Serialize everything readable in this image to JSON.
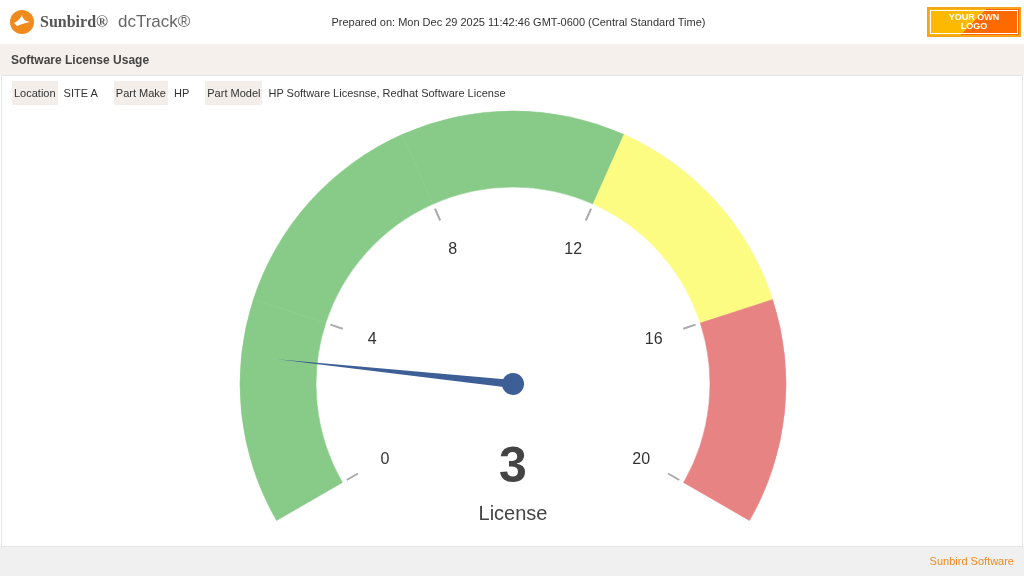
{
  "header": {
    "brand": "Sunbird®",
    "product": "dcTrack®",
    "prepared_on": "Prepared on: Mon Dec 29 2025 11:42:46 GMT-0600 (Central Standard Time)",
    "custom_logo": "YOUR OWN LOGO"
  },
  "report": {
    "title": "Software License Usage",
    "filters": [
      {
        "label": "Location",
        "value": "SITE A"
      },
      {
        "label": "Part Make",
        "value": "HP"
      },
      {
        "label": "Part Model",
        "value": "HP Software Licesnse, Redhat Software License"
      }
    ],
    "gauge": {
      "value": "3",
      "unit": "License",
      "ticks": [
        {
          "label": "0"
        },
        {
          "label": "4",
          "color": "#88cb88"
        },
        {
          "label": "8",
          "color": "#88cb88"
        },
        {
          "label": "12",
          "color": "#88cb88"
        },
        {
          "label": "16",
          "color": "#fcfc82"
        },
        {
          "label": "20",
          "color": "#e88384"
        }
      ]
    }
  },
  "footer": {
    "text": "Sunbird Software"
  }
}
